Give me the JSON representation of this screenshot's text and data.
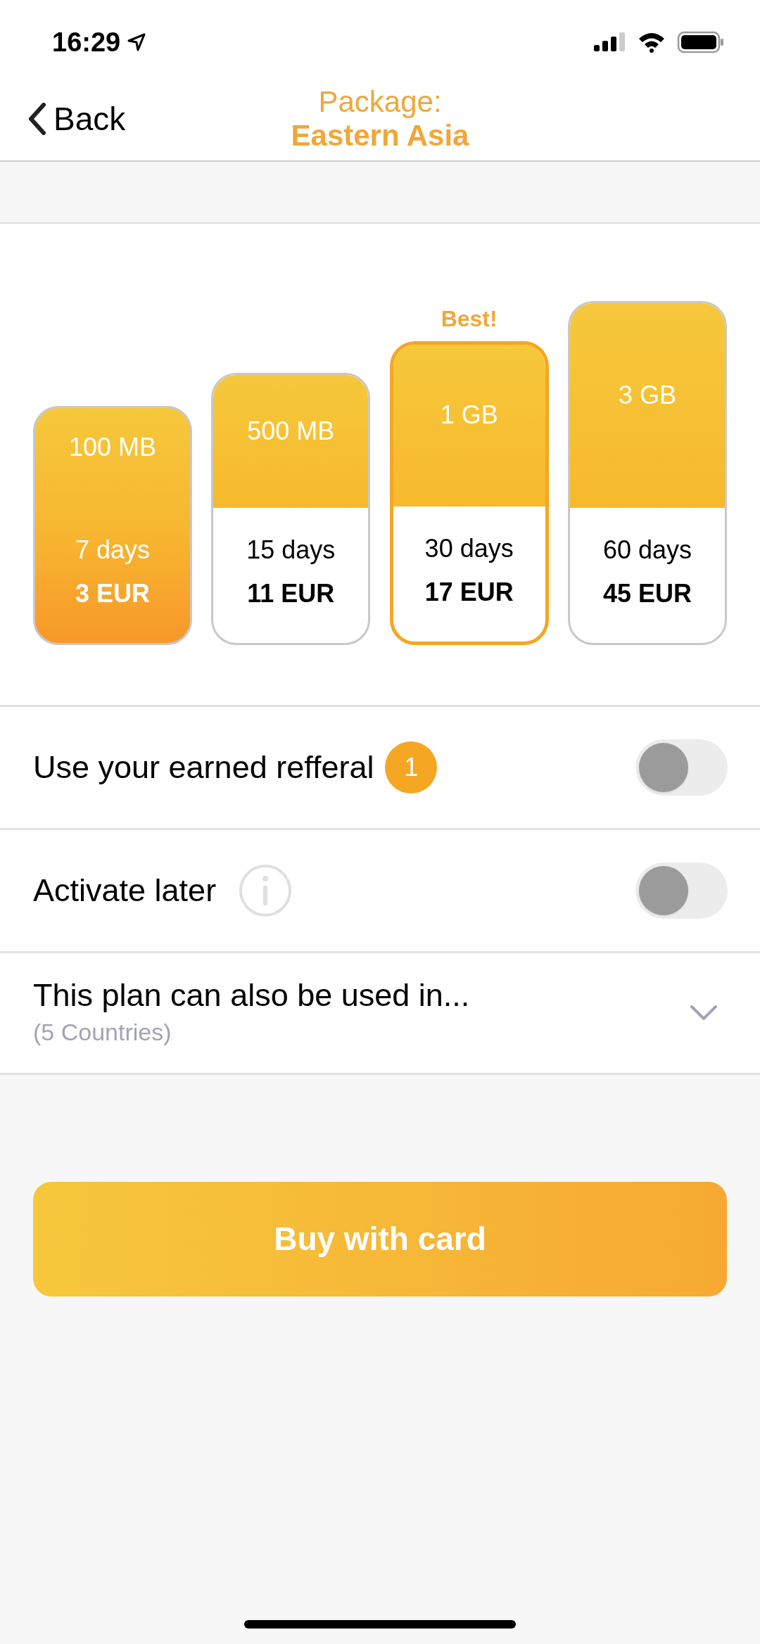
{
  "status_bar": {
    "time": "16:29"
  },
  "nav": {
    "back": "Back",
    "title": "Package:",
    "subtitle": "Eastern Asia"
  },
  "plans": [
    {
      "data": "100 MB",
      "days": "7 days",
      "price": "3 EUR",
      "selected": true
    },
    {
      "data": "500 MB",
      "days": "15 days",
      "price": "11 EUR",
      "selected": false
    },
    {
      "data": "1 GB",
      "days": "30 days",
      "price": "17 EUR",
      "selected": false,
      "badge": "Best!"
    },
    {
      "data": "3 GB",
      "days": "60 days",
      "price": "45 EUR",
      "selected": false
    }
  ],
  "options": [
    {
      "kind": "toggle",
      "label": "Use your earned refferal",
      "count": "1",
      "on": false
    },
    {
      "kind": "toggle",
      "label": "Activate later",
      "info": true,
      "on": false
    },
    {
      "kind": "expand",
      "label": "This plan can also be used in...",
      "sublabel": "(5 Countries)",
      "expanded": false
    }
  ],
  "buy_button": "Buy with card"
}
